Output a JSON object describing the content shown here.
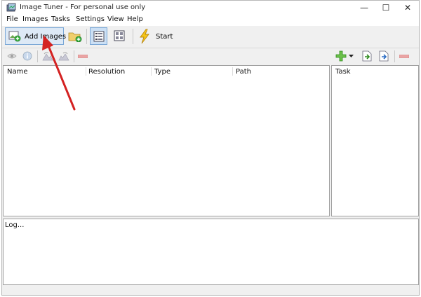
{
  "window": {
    "title": "Image Tuner - For personal use only",
    "minimize_glyph": "—",
    "maximize_glyph": "☐",
    "close_glyph": "✕"
  },
  "menu": [
    "File",
    "Images",
    "Tasks",
    "Settings",
    "View",
    "Help"
  ],
  "toolbar": {
    "add_images_label": "Add Images",
    "start_label": "Start"
  },
  "images_table": {
    "columns": [
      "Name",
      "Resolution",
      "Type",
      "Path"
    ]
  },
  "tasks_table": {
    "columns": [
      "Task"
    ]
  },
  "log": {
    "label": "Log..."
  },
  "colors": {
    "accent": "#7aa7d6",
    "arrow": "#d42222",
    "add_green": "#3cb043",
    "remove_red": "#e05a5a"
  },
  "icons": [
    "add-images-icon",
    "add-folder-icon",
    "list-view-icon",
    "thumbnail-view-icon",
    "lightning-icon",
    "preview-icon",
    "info-icon",
    "rotate-left-icon",
    "rotate-right-icon",
    "remove-image-icon",
    "add-task-icon",
    "dropdown-arrow-icon",
    "import-task-icon",
    "export-task-icon",
    "remove-task-icon"
  ]
}
